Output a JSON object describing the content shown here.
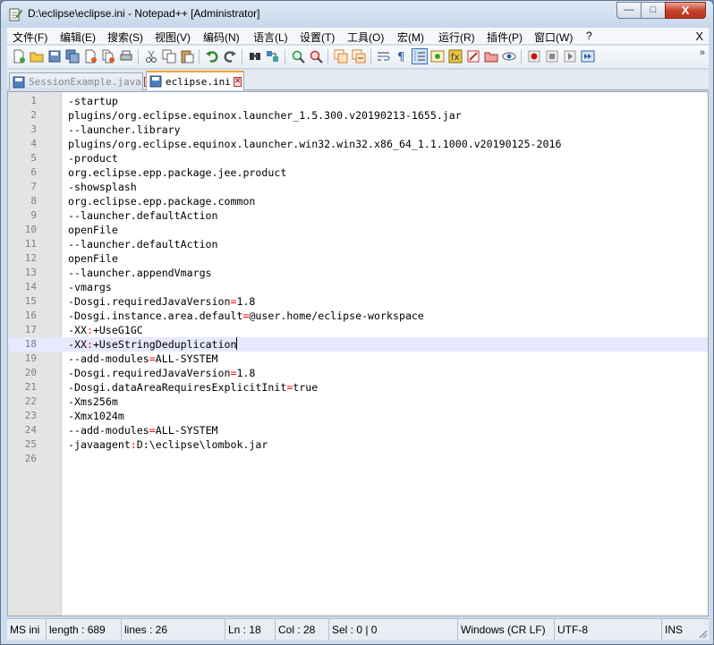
{
  "window": {
    "title": "D:\\eclipse\\eclipse.ini - Notepad++ [Administrator]",
    "controls": {
      "minimize": "—",
      "maximize": "□",
      "close": "X"
    }
  },
  "menubar": {
    "items": [
      "文件(F)",
      "编辑(E)",
      "搜索(S)",
      "视图(V)",
      "编码(N)",
      "语言(L)",
      "设置(T)",
      "工具(O)",
      "宏(M)",
      "运行(R)",
      "插件(P)",
      "窗口(W)",
      "?"
    ],
    "close_label": "X"
  },
  "toolbar": {
    "buttons": [
      "new-file",
      "open-file",
      "save",
      "save-all",
      "close",
      "close-all",
      "print",
      "cut",
      "copy",
      "paste",
      "undo",
      "redo",
      "find",
      "replace",
      "zoom-in",
      "zoom-out",
      "sync-vertical",
      "sync-horizontal",
      "word-wrap",
      "show-all-characters",
      "indent-guide",
      "document-map",
      "function-list",
      "folder-as-workspace",
      "monitoring",
      "start-recording",
      "stop-recording",
      "playback",
      "run-macro-multiple"
    ],
    "more": "»",
    "active_button": "indent-guide"
  },
  "tabs": [
    {
      "label": "SessionExample.java",
      "active": false
    },
    {
      "label": "eclipse.ini",
      "active": true
    }
  ],
  "editor": {
    "current_line": 18,
    "lines": [
      "-startup",
      "plugins/org.eclipse.equinox.launcher_1.5.300.v20190213-1655.jar",
      "--launcher.library",
      "plugins/org.eclipse.equinox.launcher.win32.win32.x86_64_1.1.1000.v20190125-2016",
      "-product",
      "org.eclipse.epp.package.jee.product",
      "-showsplash",
      "org.eclipse.epp.package.common",
      "--launcher.defaultAction",
      "openFile",
      "--launcher.defaultAction",
      "openFile",
      "--launcher.appendVmargs",
      "-vmargs",
      "-Dosgi.requiredJavaVersion=1.8",
      "-Dosgi.instance.area.default=@user.home/eclipse-workspace",
      "-XX:+UseG1GC",
      "-XX:+UseStringDeduplication",
      "--add-modules=ALL-SYSTEM",
      "-Dosgi.requiredJavaVersion=1.8",
      "-Dosgi.dataAreaRequiresExplicitInit=true",
      "-Xms256m",
      "-Xmx1024m",
      "--add-modules=ALL-SYSTEM",
      "-javaagent:D:\\eclipse\\lombok.jar",
      ""
    ]
  },
  "statusbar": {
    "file_type": "MS ini",
    "length": "length : 689",
    "lines": "lines : 26",
    "ln": "Ln : 18",
    "col": "Col : 28",
    "sel": "Sel : 0 | 0",
    "eol": "Windows (CR LF)",
    "encoding": "UTF-8",
    "mode": "INS"
  },
  "colors": {
    "operator": "#ff0000",
    "accent_tab": "#f7a338",
    "current_line": "#e8e8ff"
  }
}
